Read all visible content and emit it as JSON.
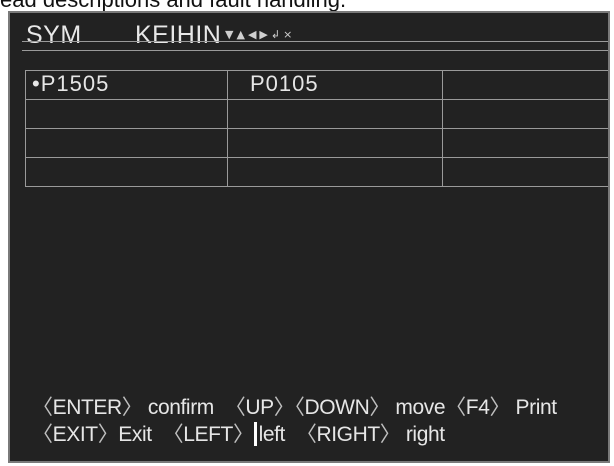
{
  "caption": "ead descriptions and fault handling.",
  "header": {
    "brand": "SYM",
    "ecu": "KEIHIN",
    "icons": [
      "triangle-down-icon",
      "triangle-up-icon",
      "triangle-left-icon",
      "triangle-right-icon",
      "enter-icon",
      "close-icon"
    ]
  },
  "codes": {
    "rows": [
      [
        "•P1505",
        "P0105",
        ""
      ],
      [
        "",
        "",
        ""
      ],
      [
        "",
        "",
        ""
      ],
      [
        "",
        "",
        ""
      ]
    ]
  },
  "footer": {
    "line1": {
      "k_enter": "ENTER",
      "t_confirm": "confirm",
      "k_up": "UP",
      "k_down": "DOWN",
      "t_move": "move",
      "k_f4": "F4",
      "t_print": "Print"
    },
    "line2": {
      "k_exit": "EXIT",
      "t_exit": "Exit",
      "k_left": "LEFT",
      "t_left": "left",
      "k_right": "RIGHT",
      "t_right": "right"
    }
  }
}
